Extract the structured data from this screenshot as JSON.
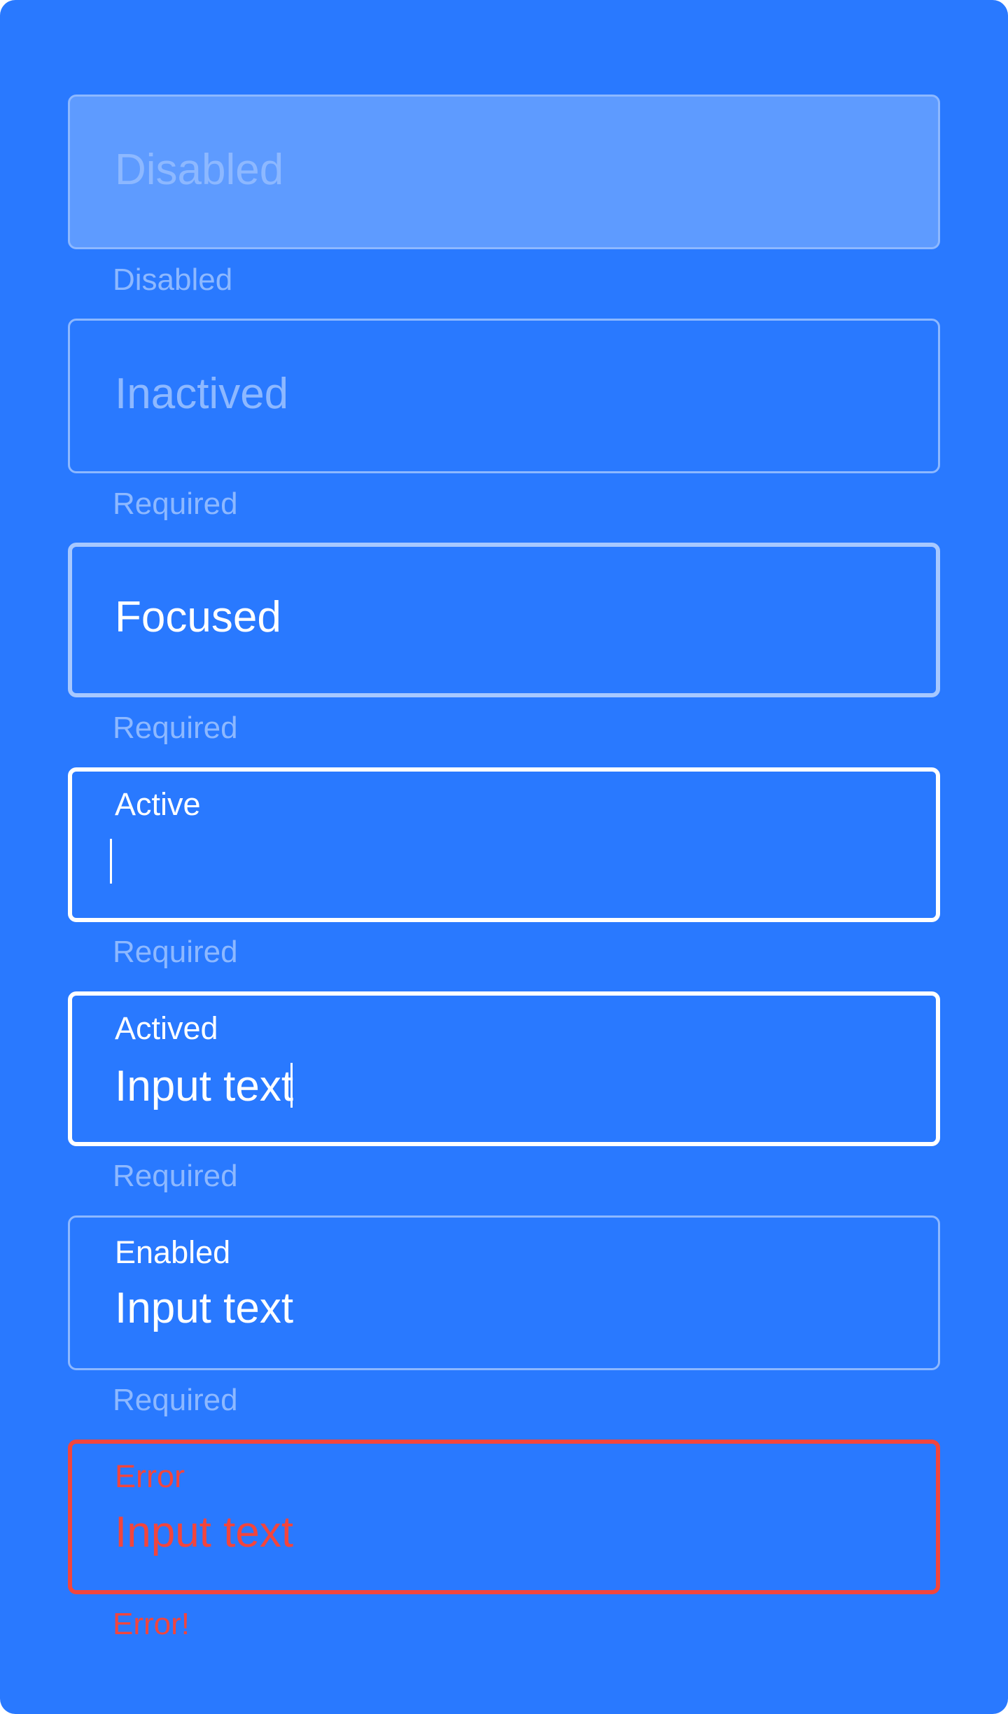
{
  "colors": {
    "panel_background": "#2979FF",
    "disabled_fill": "#5E9BFF",
    "muted_text": "#8DB8FF",
    "white": "#FFFFFF",
    "error": "#F2453D"
  },
  "fields": {
    "disabled": {
      "placeholder": "Disabled",
      "helper": "Disabled"
    },
    "inactived": {
      "placeholder": "Inactived",
      "helper": "Required"
    },
    "focused": {
      "placeholder": "Focused",
      "helper": "Required"
    },
    "active": {
      "label": "Active",
      "value": "",
      "helper": "Required"
    },
    "actived": {
      "label": "Actived",
      "value": "Input text",
      "helper": "Required"
    },
    "enabled": {
      "label": "Enabled",
      "value": "Input text",
      "helper": "Required"
    },
    "error": {
      "label": "Error",
      "value": "Input text",
      "helper": "Error!"
    }
  }
}
